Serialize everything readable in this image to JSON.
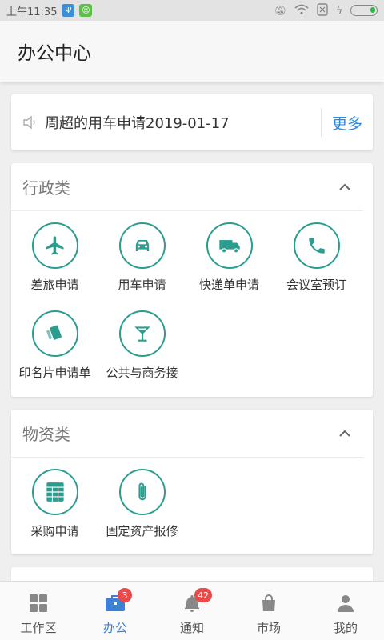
{
  "status_bar": {
    "time": "上午11:35"
  },
  "app_bar": {
    "title": "办公中心"
  },
  "notice": {
    "text": "周超的用车申请2019-01-17",
    "more_label": "更多"
  },
  "sections": {
    "admin": {
      "title": "行政类",
      "items": [
        {
          "label": "差旅申请",
          "icon": "airplane-icon"
        },
        {
          "label": "用车申请",
          "icon": "car-icon"
        },
        {
          "label": "快递单申请",
          "icon": "truck-icon"
        },
        {
          "label": "会议室预订",
          "icon": "phone-icon"
        },
        {
          "label": "印名片申请单",
          "icon": "card-icon"
        },
        {
          "label": "公共与商务接",
          "icon": "cocktail-icon"
        }
      ]
    },
    "materials": {
      "title": "物资类",
      "items": [
        {
          "label": "采购申请",
          "icon": "spreadsheet-icon"
        },
        {
          "label": "固定资产报修",
          "icon": "paperclip-icon"
        }
      ]
    }
  },
  "bottom_nav": [
    {
      "label": "工作区",
      "icon": "grid-icon"
    },
    {
      "label": "办公",
      "icon": "briefcase-icon",
      "badge": "3",
      "active": true
    },
    {
      "label": "通知",
      "icon": "bell-icon",
      "badge": "42"
    },
    {
      "label": "市场",
      "icon": "bag-icon"
    },
    {
      "label": "我的",
      "icon": "person-icon"
    }
  ],
  "colors": {
    "accent": "#2a9d8f",
    "link": "#2b8ae2",
    "badge": "#ec4a4a",
    "nav_active": "#3b82d6"
  }
}
